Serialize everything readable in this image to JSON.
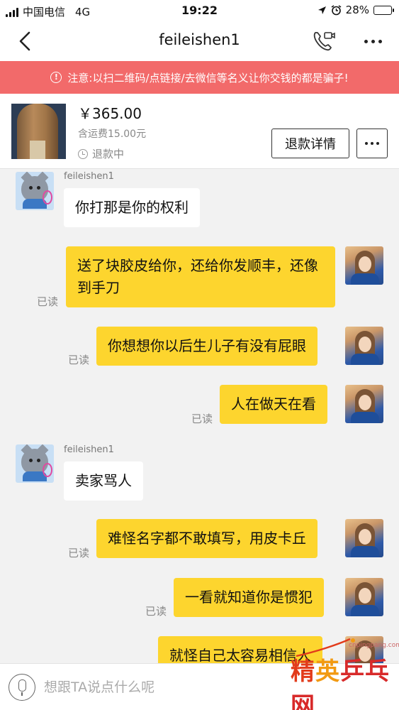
{
  "status_bar": {
    "carrier": "中国电信",
    "network": "4G",
    "time": "19:22",
    "battery": "28%",
    "battery_level": 0.28
  },
  "nav": {
    "title": "feileishen1"
  },
  "warning": {
    "text": "注意:以扫二维码/点链接/去微信等名义让你交钱的都是骗子!"
  },
  "product": {
    "price": "￥365.00",
    "shipping": "含运费15.00元",
    "status": "退款中",
    "refund_button": "退款详情"
  },
  "chat": {
    "seller_name_1": "feileishen1",
    "seller_name_2": "feileishen1",
    "messages": [
      {
        "from": "seller",
        "text": "你打那是你的权利"
      },
      {
        "from": "buyer",
        "text": "送了块胶皮给你，还给你发顺丰，还像到手刀",
        "status": "已读"
      },
      {
        "from": "buyer",
        "text": "你想想你以后生儿子有没有屁眼",
        "status": "已读"
      },
      {
        "from": "buyer",
        "text": "人在做天在看",
        "status": "已读"
      },
      {
        "from": "seller",
        "text": "卖家骂人"
      },
      {
        "from": "buyer",
        "text": "难怪名字都不敢填写，用皮卡丘",
        "status": "已读"
      },
      {
        "from": "buyer",
        "text": "一看就知道你是惯犯",
        "status": "已读"
      },
      {
        "from": "buyer",
        "text": "就怪自己太容易相信人"
      }
    ]
  },
  "input": {
    "placeholder": "想跟TA说点什么呢"
  },
  "watermark": {
    "url": "cnpingpang.com",
    "part1": "精",
    "part2": "英",
    "part3": "乒乓网"
  },
  "colors": {
    "warning_bg": "#f26a6a",
    "outgoing_bubble": "#fdd52e",
    "incoming_bubble": "#ffffff",
    "chat_bg": "#f2f2f2"
  }
}
